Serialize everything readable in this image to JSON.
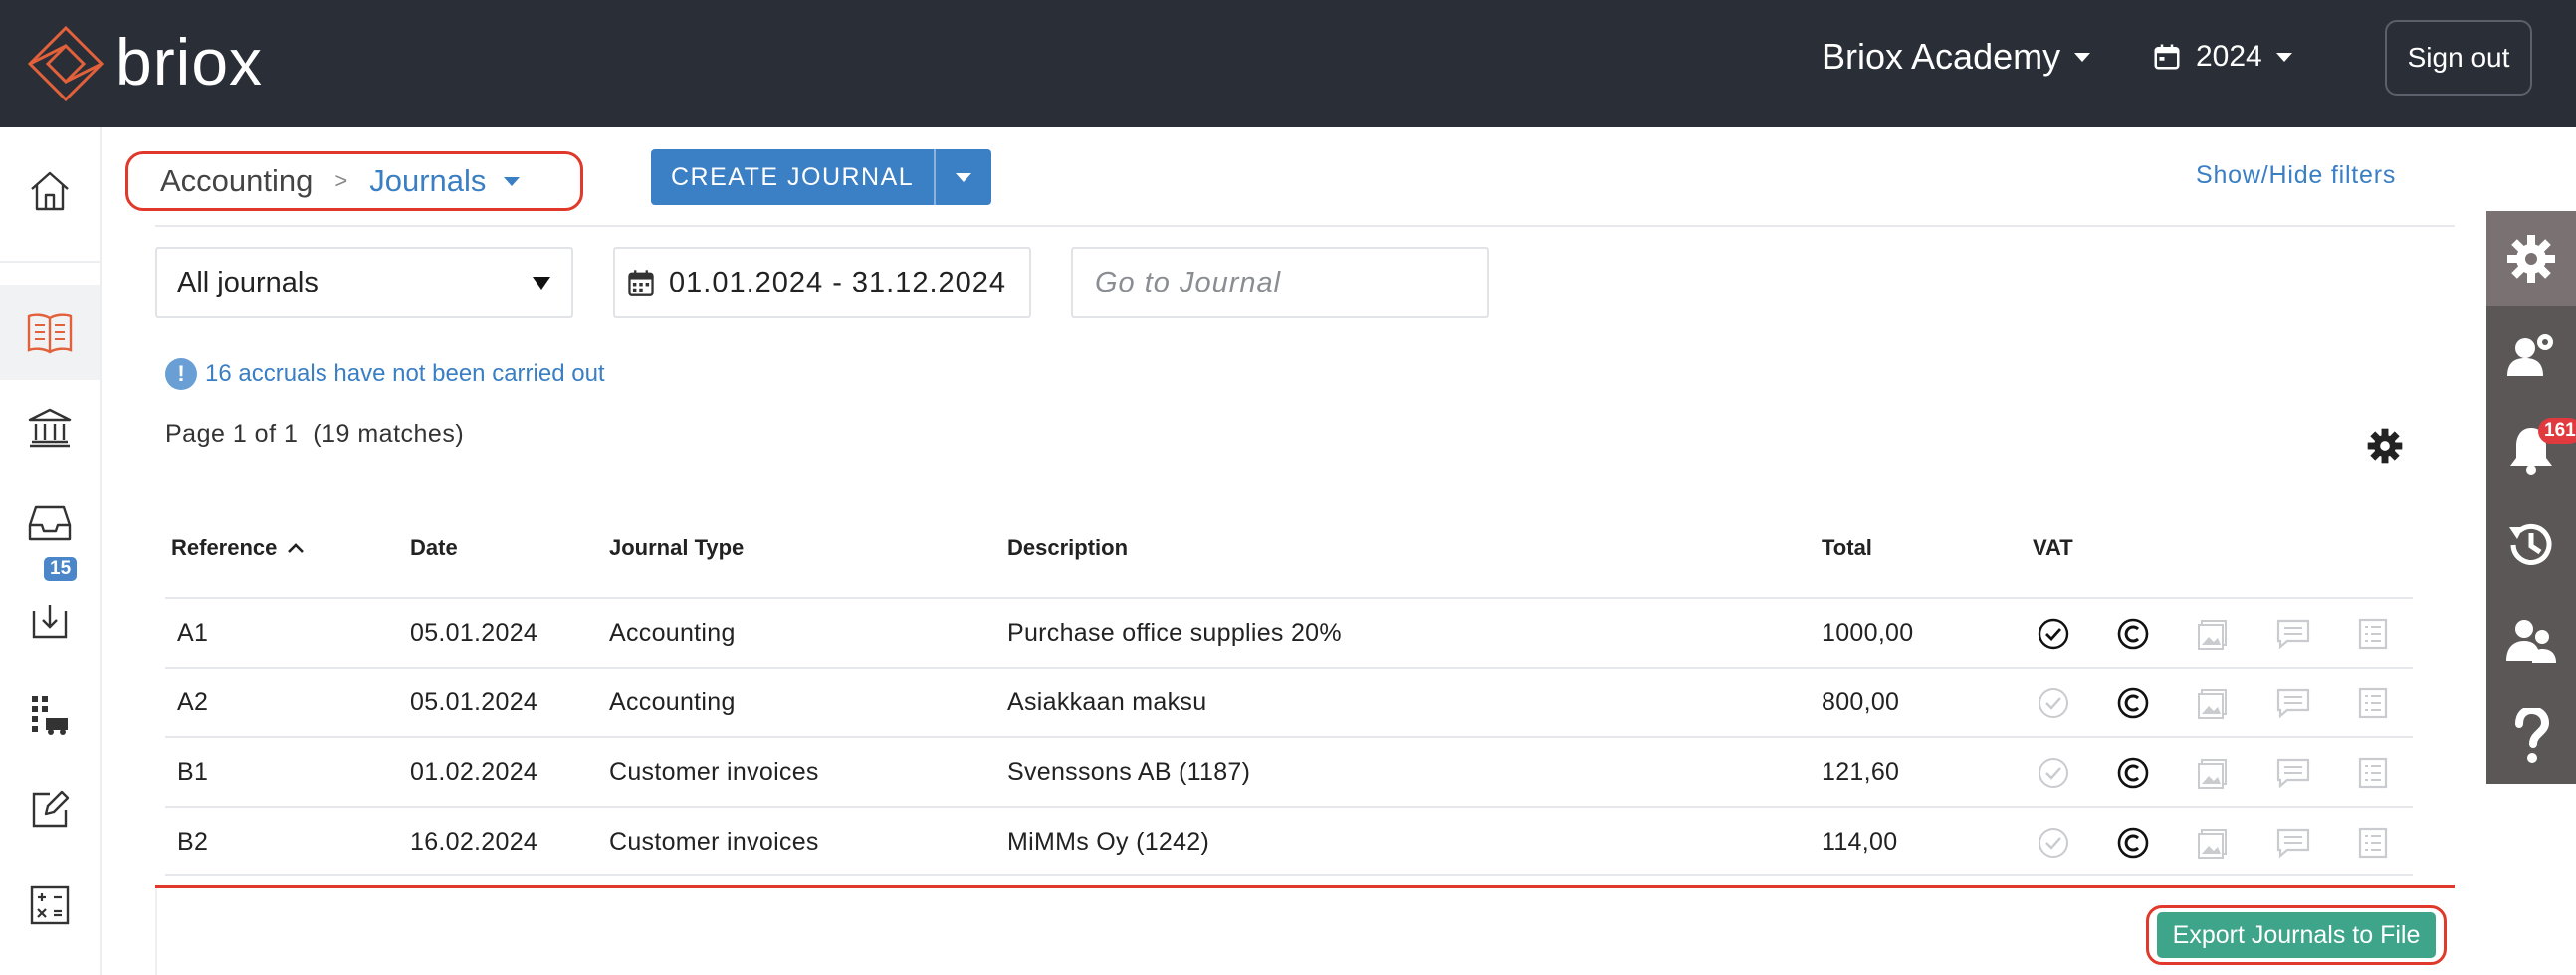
{
  "app": {
    "logo_text": "briox"
  },
  "topbar": {
    "company": "Briox Academy",
    "year": "2024",
    "signout_label": "Sign out"
  },
  "leftnav": {
    "upload_badge": "15"
  },
  "rightrail": {
    "notifications_badge": "161"
  },
  "header": {
    "breadcrumb_home": "Accounting",
    "breadcrumb_sep": ">",
    "breadcrumb_current": "Journals",
    "create_label": "CREATE JOURNAL",
    "show_hide_label": "Show/Hide filters"
  },
  "filters": {
    "journal_select": "All journals",
    "date_range": "01.01.2024 - 31.12.2024",
    "goto_placeholder": "Go to Journal"
  },
  "accrual_notice": "16 accruals have not been carried out",
  "page_info": "Page 1 of 1  (19 matches)",
  "table": {
    "headers": {
      "reference": "Reference",
      "date": "Date",
      "type": "Journal Type",
      "description": "Description",
      "total": "Total",
      "vat": "VAT"
    },
    "rows": [
      {
        "reference": "A1",
        "date": "05.01.2024",
        "type": "Accounting",
        "description": "Purchase office supplies 20%",
        "total": "1000,00",
        "vat_checked": true
      },
      {
        "reference": "A2",
        "date": "05.01.2024",
        "type": "Accounting",
        "description": "Asiakkaan maksu",
        "total": "800,00",
        "vat_checked": false
      },
      {
        "reference": "B1",
        "date": "01.02.2024",
        "type": "Customer invoices",
        "description": "Svenssons AB (1187)",
        "total": "121,60",
        "vat_checked": false
      },
      {
        "reference": "B2",
        "date": "16.02.2024",
        "type": "Customer invoices",
        "description": "MiMMs Oy (1242)",
        "total": "114,00",
        "vat_checked": false
      }
    ]
  },
  "export_label": "Export Journals to File",
  "colors": {
    "topbar": "#2a2f37",
    "accent": "#3b7fc5",
    "brand_orange": "#e2603a",
    "highlight_red": "#e0392b",
    "export_green": "#3fa58a",
    "rail": "#5c5757"
  }
}
